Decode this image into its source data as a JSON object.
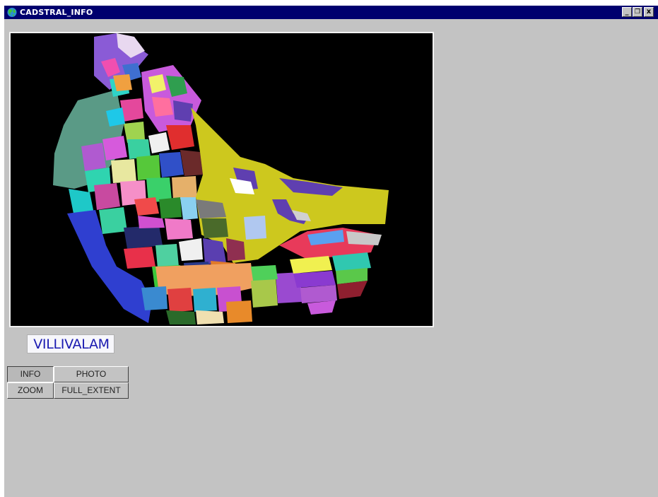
{
  "window": {
    "title": "CADSTRAL_INFO",
    "controls": {
      "minimize": "_",
      "restore": "❐",
      "close": "x"
    }
  },
  "map": {
    "background_color": "#000000"
  },
  "village": {
    "name": "VILLIVALAM"
  },
  "buttons": {
    "info": "INFO",
    "photo": "PHOTO",
    "zoom": "ZOOM",
    "full_extent": "FULL_EXTENT"
  }
}
